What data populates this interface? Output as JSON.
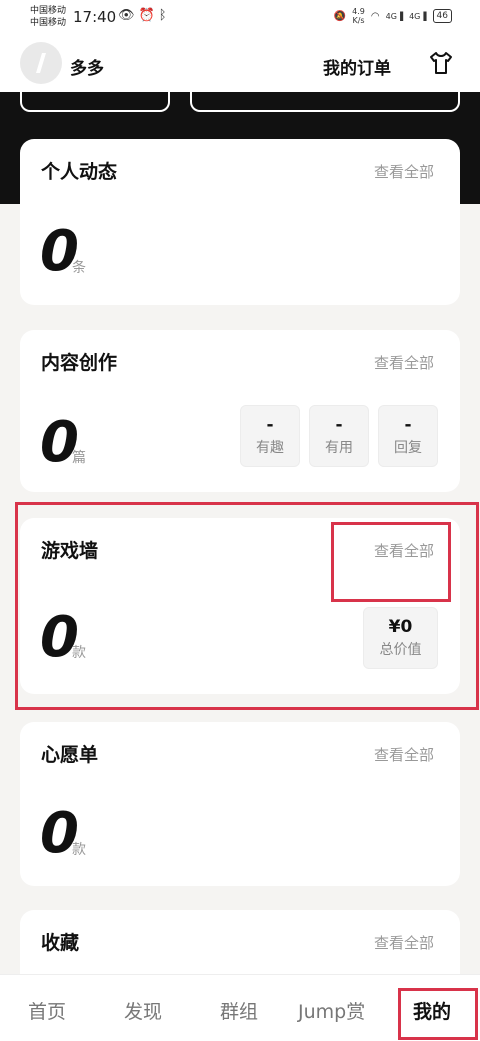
{
  "status_bar": {
    "carrier_1": "中国移动",
    "carrier_2": "中国移动",
    "time": "17:40",
    "net_speed_value": "4.9",
    "net_speed_unit": "K/s",
    "signal_label_1": "4G",
    "signal_label_2": "4G",
    "battery": "46"
  },
  "header": {
    "username": "多多",
    "orders_label": "我的订单"
  },
  "cards": {
    "activity": {
      "title": "个人动态",
      "view_all": "查看全部",
      "count": "0",
      "unit": "条"
    },
    "content": {
      "title": "内容创作",
      "view_all": "查看全部",
      "count": "0",
      "unit": "篇",
      "stats": [
        {
          "value": "-",
          "label": "有趣"
        },
        {
          "value": "-",
          "label": "有用"
        },
        {
          "value": "-",
          "label": "回复"
        }
      ]
    },
    "game_wall": {
      "title": "游戏墙",
      "view_all": "查看全部",
      "count": "0",
      "unit": "款",
      "total_value": "¥0",
      "total_label": "总价值"
    },
    "wishlist": {
      "title": "心愿单",
      "view_all": "查看全部",
      "count": "0",
      "unit": "款"
    },
    "favorites": {
      "title": "收藏",
      "view_all": "查看全部"
    }
  },
  "bottom_nav": {
    "items": [
      "首页",
      "发现",
      "群组",
      "Jump赏",
      "我的"
    ],
    "active_index": 4
  },
  "colors": {
    "highlight": "#d8334a",
    "banner": "#111111",
    "background": "#f5f4f2"
  }
}
